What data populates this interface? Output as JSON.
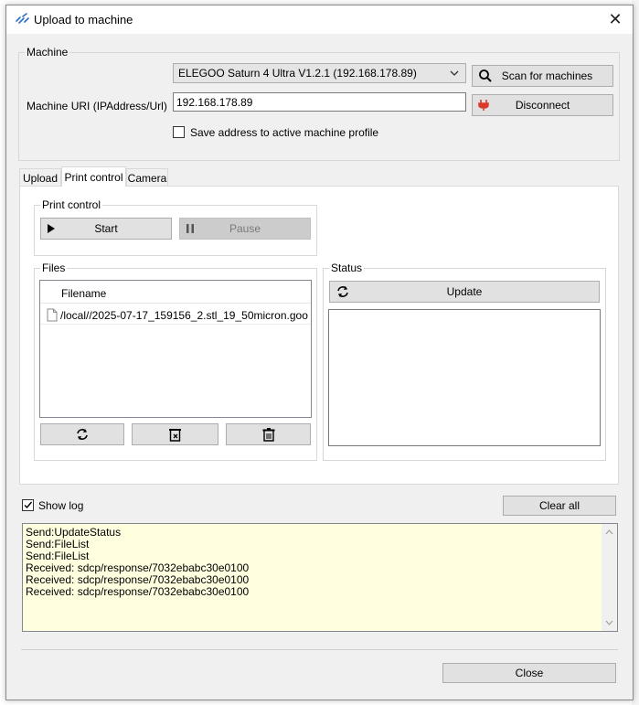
{
  "window": {
    "title": "Upload to machine"
  },
  "machine": {
    "legend": "Machine",
    "selected_machine": "ELEGOO Saturn 4 Ultra V1.2.1 (192.168.178.89)",
    "uri_label": "Machine URI (IPAddress/Url)",
    "uri_value": "192.168.178.89",
    "save_address_label": "Save address to active machine profile",
    "scan_label": "Scan for machines",
    "disconnect_label": "Disconnect"
  },
  "tabs": [
    {
      "label": "Upload",
      "active": false
    },
    {
      "label": "Print control",
      "active": true
    },
    {
      "label": "Camera",
      "active": false
    }
  ],
  "print_control": {
    "legend": "Print control",
    "start_label": "Start",
    "pause_label": "Pause"
  },
  "files": {
    "legend": "Files",
    "column_header": "Filename",
    "rows": [
      "/local//2025-07-17_159156_2.stl_19_50micron.goo"
    ]
  },
  "status": {
    "legend": "Status",
    "update_label": "Update"
  },
  "log": {
    "show_log_label": "Show log",
    "clear_all_label": "Clear all",
    "lines": [
      "Send:UpdateStatus",
      "Send:FileList",
      "Send:FileList",
      "Received: sdcp/response/7032ebabc30e0100",
      "Received: sdcp/response/7032ebabc30e0100",
      "Received: sdcp/response/7032ebabc30e0100"
    ]
  },
  "footer": {
    "close_label": "Close"
  },
  "colors": {
    "log_background": "#ffffe0",
    "disconnect_icon": "#d93a2b",
    "button_face": "#e1e1e1"
  }
}
